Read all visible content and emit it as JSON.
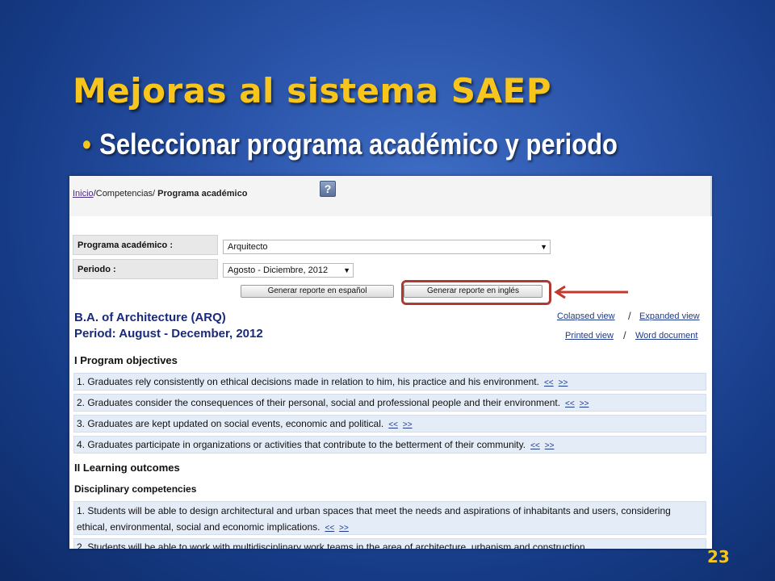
{
  "slide": {
    "title": "Mejoras al sistema SAEP",
    "bullet": "Seleccionar programa académico y periodo",
    "page_number": "23"
  },
  "app": {
    "breadcrumb": {
      "home": "Inicio",
      "middle": "/Competencias/ ",
      "current": "Programa académico"
    },
    "help_icon": "?",
    "form": {
      "program_label": "Programa académico :",
      "program_value": "Arquitecto",
      "period_label": "Periodo :",
      "period_value": "Agosto - Diciembre, 2012"
    },
    "buttons": {
      "spanish": "Generar reporte en español",
      "english": "Generar reporte en inglés"
    },
    "program": {
      "title": "B.A. of Architecture (ARQ)",
      "period": "Period: August - December, 2012"
    },
    "view_links": {
      "collapsed": "Colapsed view",
      "expanded": "Expanded view",
      "printed": "Printed view",
      "word": "Word document",
      "separator": "/"
    },
    "nav": {
      "prev": "<<",
      "next": ">>"
    },
    "sections": {
      "objectives_title": "I Program objectives",
      "objectives": [
        "1. Graduates rely consistently on ethical decisions made in relation to him, his practice and his environment.",
        "2. Graduates consider the consequences of their personal, social and professional people and their environment.",
        "3. Graduates are kept updated on social events, economic and political.",
        "4. Graduates participate in organizations or activities that contribute to the betterment of their community."
      ],
      "outcomes_title": "II Learning outcomes",
      "disciplinary_title": "Disciplinary competencies",
      "competencies": [
        "1. Students will be able to design architectural and urban spaces that meet the needs and aspirations of inhabitants and users, considering ethical, environmental, social and economic implications.",
        "2. Students will be able to work with multidisciplinary work teams in the area of architecture, urbanism and construction"
      ]
    }
  }
}
